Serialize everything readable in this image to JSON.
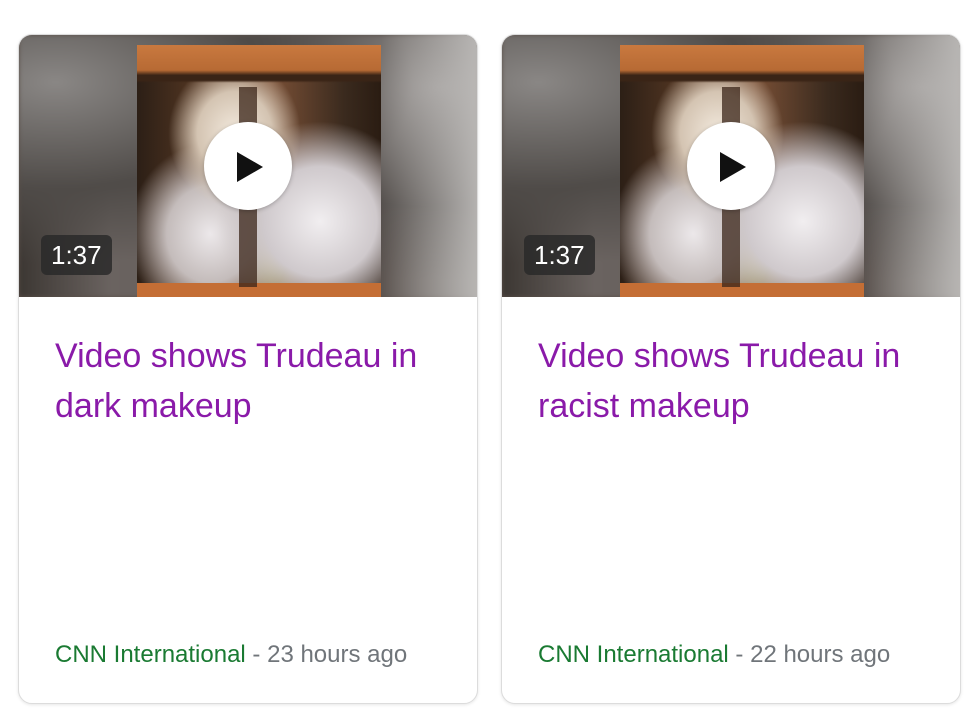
{
  "cards": [
    {
      "duration": "1:37",
      "title": "Video shows Trudeau in dark makeup",
      "source": "CNN International",
      "separator": " - ",
      "time_ago": "23 hours ago"
    },
    {
      "duration": "1:37",
      "title": "Video shows Trudeau in racist makeup",
      "source": "CNN International",
      "separator": " - ",
      "time_ago": "22 hours ago"
    }
  ],
  "icons": {
    "play": "play-icon"
  },
  "colors": {
    "title": "#8a1aa9",
    "source": "#1a7a32",
    "meta": "#70757a",
    "duration_bg": "#282828"
  }
}
